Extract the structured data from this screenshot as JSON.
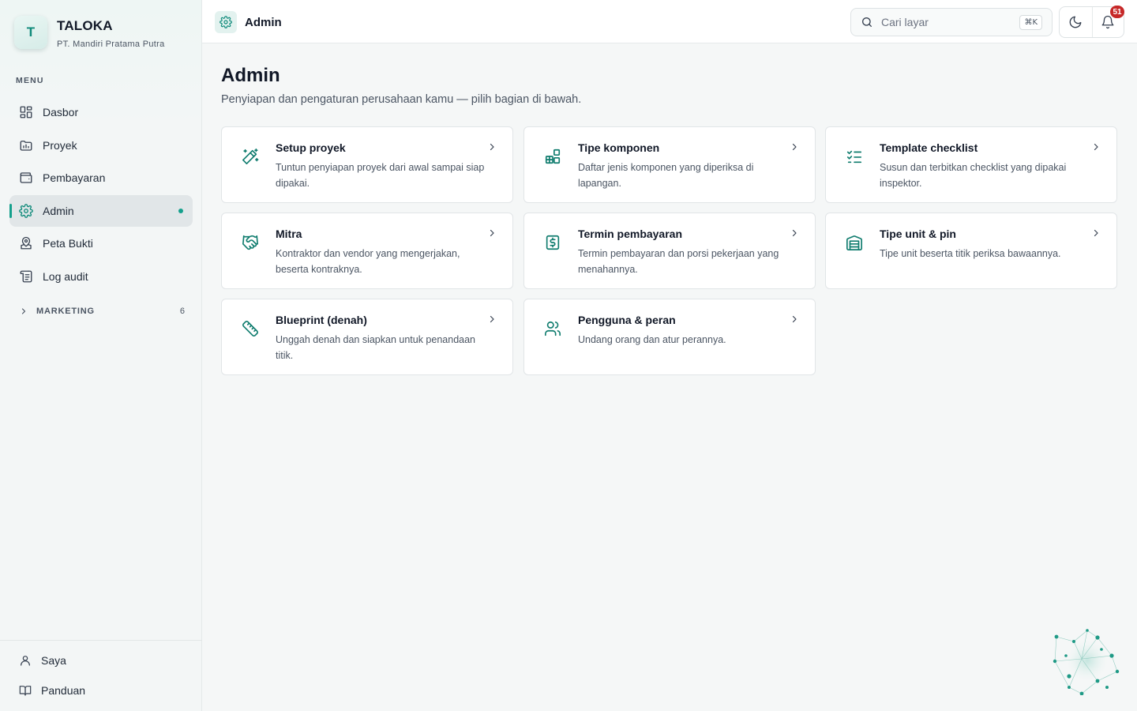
{
  "brand": {
    "logo_letter": "T",
    "name": "TALOKA",
    "company": "PT. Mandiri Pratama Putra"
  },
  "sidebar": {
    "menu_heading": "MENU",
    "items": [
      {
        "label": "Dasbor",
        "icon": "dashboard-icon"
      },
      {
        "label": "Proyek",
        "icon": "folder-icon"
      },
      {
        "label": "Pembayaran",
        "icon": "wallet-icon"
      },
      {
        "label": "Admin",
        "icon": "gear-icon",
        "active": true
      },
      {
        "label": "Peta Bukti",
        "icon": "map-pin-icon"
      },
      {
        "label": "Log audit",
        "icon": "log-icon"
      }
    ],
    "group": {
      "label": "MARKETING",
      "count": "6",
      "expanded": false
    },
    "footer": [
      {
        "label": "Saya",
        "icon": "user-icon"
      },
      {
        "label": "Panduan",
        "icon": "book-icon"
      }
    ]
  },
  "topbar": {
    "title": "Admin",
    "search": {
      "placeholder": "Cari layar",
      "shortcut": "⌘K"
    },
    "notifications_count": "51"
  },
  "main": {
    "title": "Admin",
    "subtitle": "Penyiapan dan pengaturan perusahaan kamu — pilih bagian di bawah.",
    "cards": [
      {
        "title": "Setup proyek",
        "desc": "Tuntun penyiapan proyek dari awal sampai siap dipakai.",
        "icon": "magic-wand-icon"
      },
      {
        "title": "Tipe komponen",
        "desc": "Daftar jenis komponen yang diperiksa di lapangan.",
        "icon": "components-icon"
      },
      {
        "title": "Template checklist",
        "desc": "Susun dan terbitkan checklist yang dipakai inspektor.",
        "icon": "checklist-icon"
      },
      {
        "title": "Mitra",
        "desc": "Kontraktor dan vendor yang mengerjakan, beserta kontraknya.",
        "icon": "handshake-icon"
      },
      {
        "title": "Termin pembayaran",
        "desc": "Termin pembayaran dan porsi pekerjaan yang menahannya.",
        "icon": "receipt-dollar-icon"
      },
      {
        "title": "Tipe unit & pin",
        "desc": "Tipe unit beserta titik periksa bawaannya.",
        "icon": "warehouse-icon"
      },
      {
        "title": "Blueprint (denah)",
        "desc": "Unggah denah dan siapkan untuk penandaan titik.",
        "icon": "ruler-icon"
      },
      {
        "title": "Pengguna & peran",
        "desc": "Undang orang dan atur perannya.",
        "icon": "users-icon"
      }
    ]
  },
  "colors": {
    "accent": "#14a08c",
    "accent_dark": "#0f7c6e",
    "badge": "#c62828",
    "sidebar_bg": "#f3f6f6",
    "page_bg": "#f5f7f7"
  }
}
